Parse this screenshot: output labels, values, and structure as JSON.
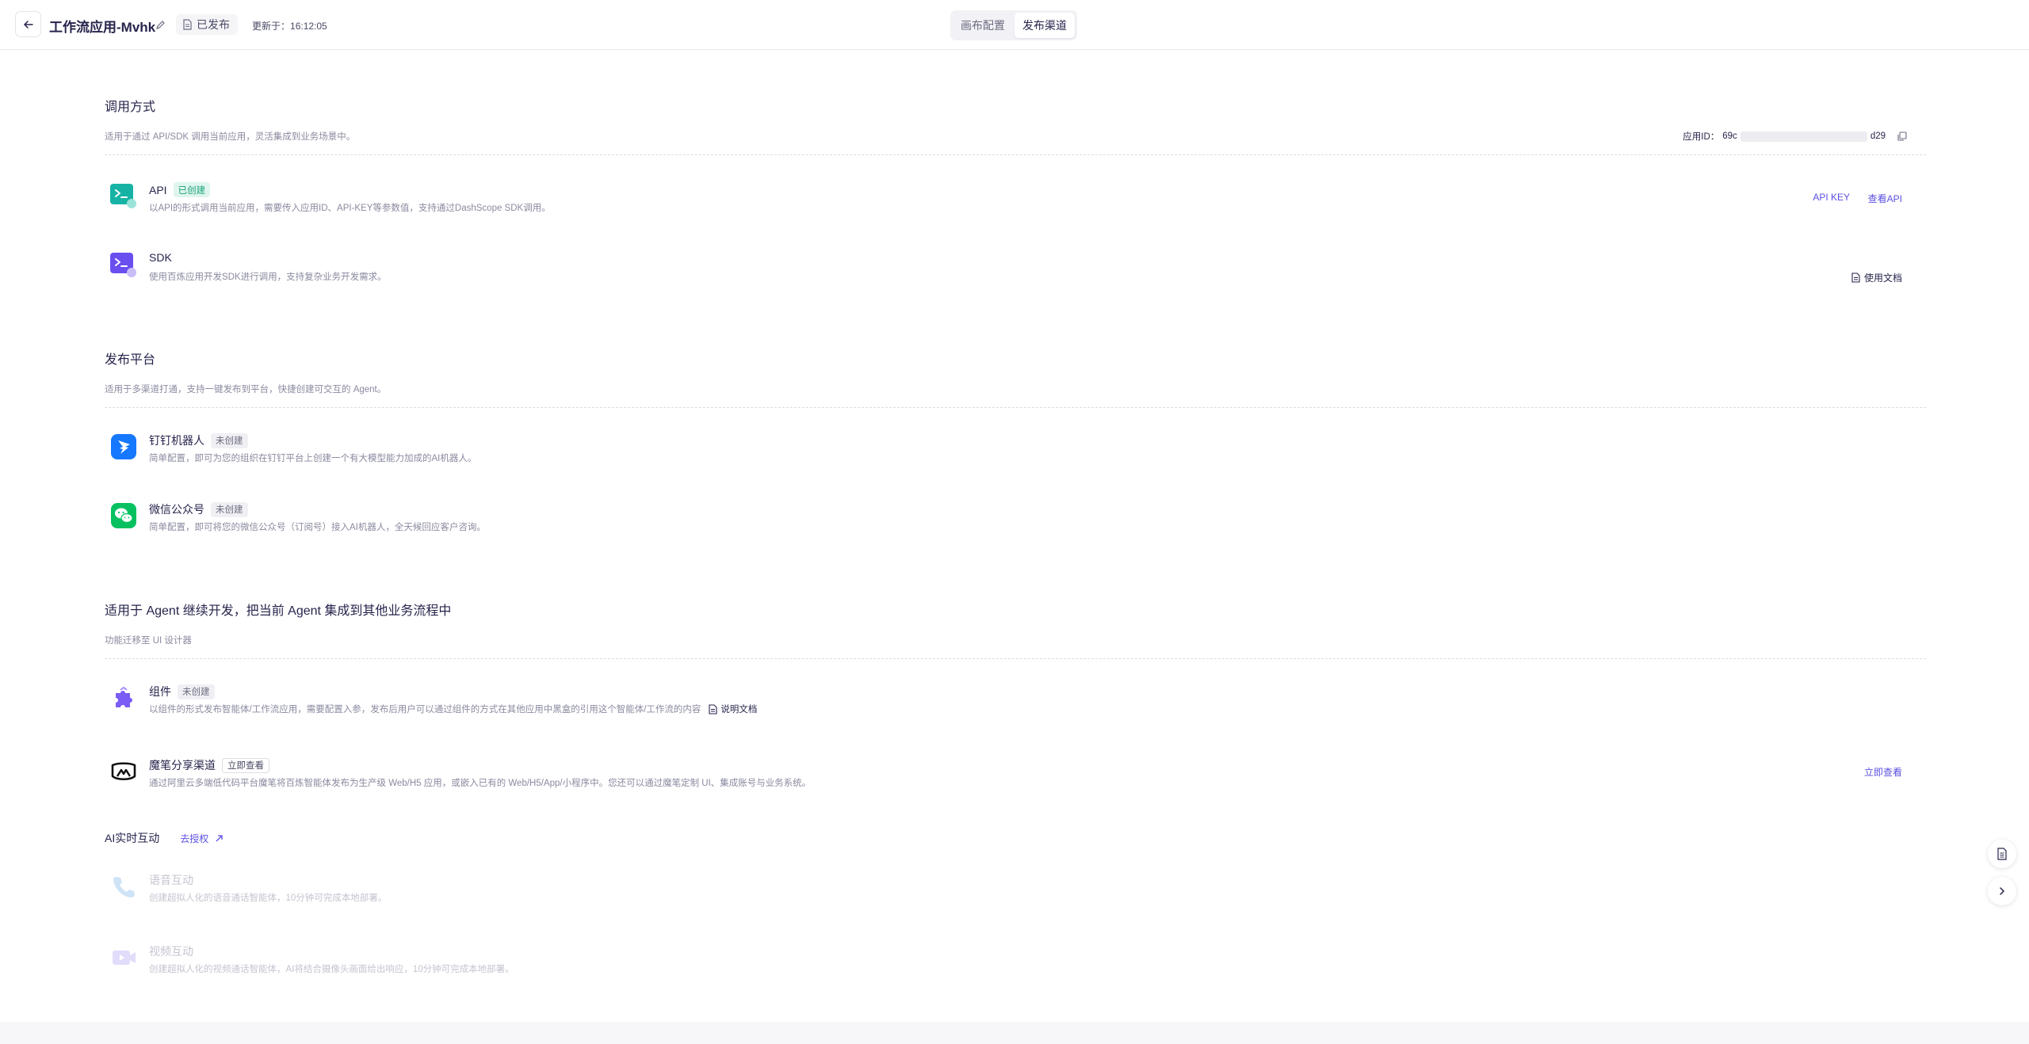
{
  "header": {
    "title": "工作流应用-Mvhk",
    "status": "已发布",
    "updated_label": "更新于：",
    "updated_time": "16:12:05",
    "tabs": [
      {
        "label": "画布配置",
        "active": false
      },
      {
        "label": "发布渠道",
        "active": true
      }
    ]
  },
  "invoke": {
    "title": "调用方式",
    "desc": "适用于通过 API/SDK 调用当前应用，灵活集成到业务场景中。",
    "app_id_label": "应用ID：",
    "app_id_prefix": "69c",
    "app_id_suffix": "d29",
    "items": [
      {
        "name": "API",
        "badge": "已创建",
        "desc": "以API的形式调用当前应用，需要传入应用ID、API-KEY等参数值，支持通过DashScope SDK调用。",
        "actions": [
          "API KEY",
          "查看API"
        ]
      },
      {
        "name": "SDK",
        "desc": "使用百炼应用开发SDK进行调用，支持复杂业务开发需求。",
        "doc_label": "使用文档"
      }
    ]
  },
  "publish": {
    "title": "发布平台",
    "desc": "适用于多渠道打通，支持一键发布到平台，快捷创建可交互的 Agent。",
    "items": [
      {
        "name": "钉钉机器人",
        "badge": "未创建",
        "desc": "简单配置，即可为您的组织在钉钉平台上创建一个有大模型能力加成的AI机器人。"
      },
      {
        "name": "微信公众号",
        "badge": "未创建",
        "desc": "简单配置，即可将您的微信公众号（订阅号）接入AI机器人，全天候回应客户咨询。"
      }
    ]
  },
  "agent_dev": {
    "title": "适用于 Agent 继续开发，把当前 Agent 集成到其他业务流程中",
    "desc": "功能迁移至 UI 设计器",
    "items": [
      {
        "name": "组件",
        "badge": "未创建",
        "desc": "以组件的形式发布智能体/工作流应用，需要配置入参，发布后用户可以通过组件的方式在其他应用中黑盒的引用这个智能体/工作流的内容",
        "doc_label": "说明文档"
      },
      {
        "name": "魔笔分享渠道",
        "badge": "立即查看",
        "desc": "通过阿里云多端低代码平台魔笔将百炼智能体发布为生产级 Web/H5 应用，或嵌入已有的 Web/H5/App/小程序中。您还可以通过魔笔定制 UI、集成账号与业务系统。",
        "action": "立即查看"
      }
    ]
  },
  "ai_realtime": {
    "title": "AI实时互动",
    "auth_link": "去授权",
    "items": [
      {
        "name": "语音互动",
        "desc": "创建超拟人化的语音通话智能体，10分钟可完成本地部署。"
      },
      {
        "name": "视频互动",
        "desc": "创建超拟人化的视频通话智能体，AI将结合摄像头画面给出响应，10分钟可完成本地部署。"
      }
    ]
  },
  "colors": {
    "accent": "#5b4fe0",
    "created_badge": "#1aa37a",
    "api_icon": "#16b3a5",
    "sdk_icon": "#6b4ef0",
    "dingtalk": "#1677ff",
    "wechat": "#07c160"
  }
}
